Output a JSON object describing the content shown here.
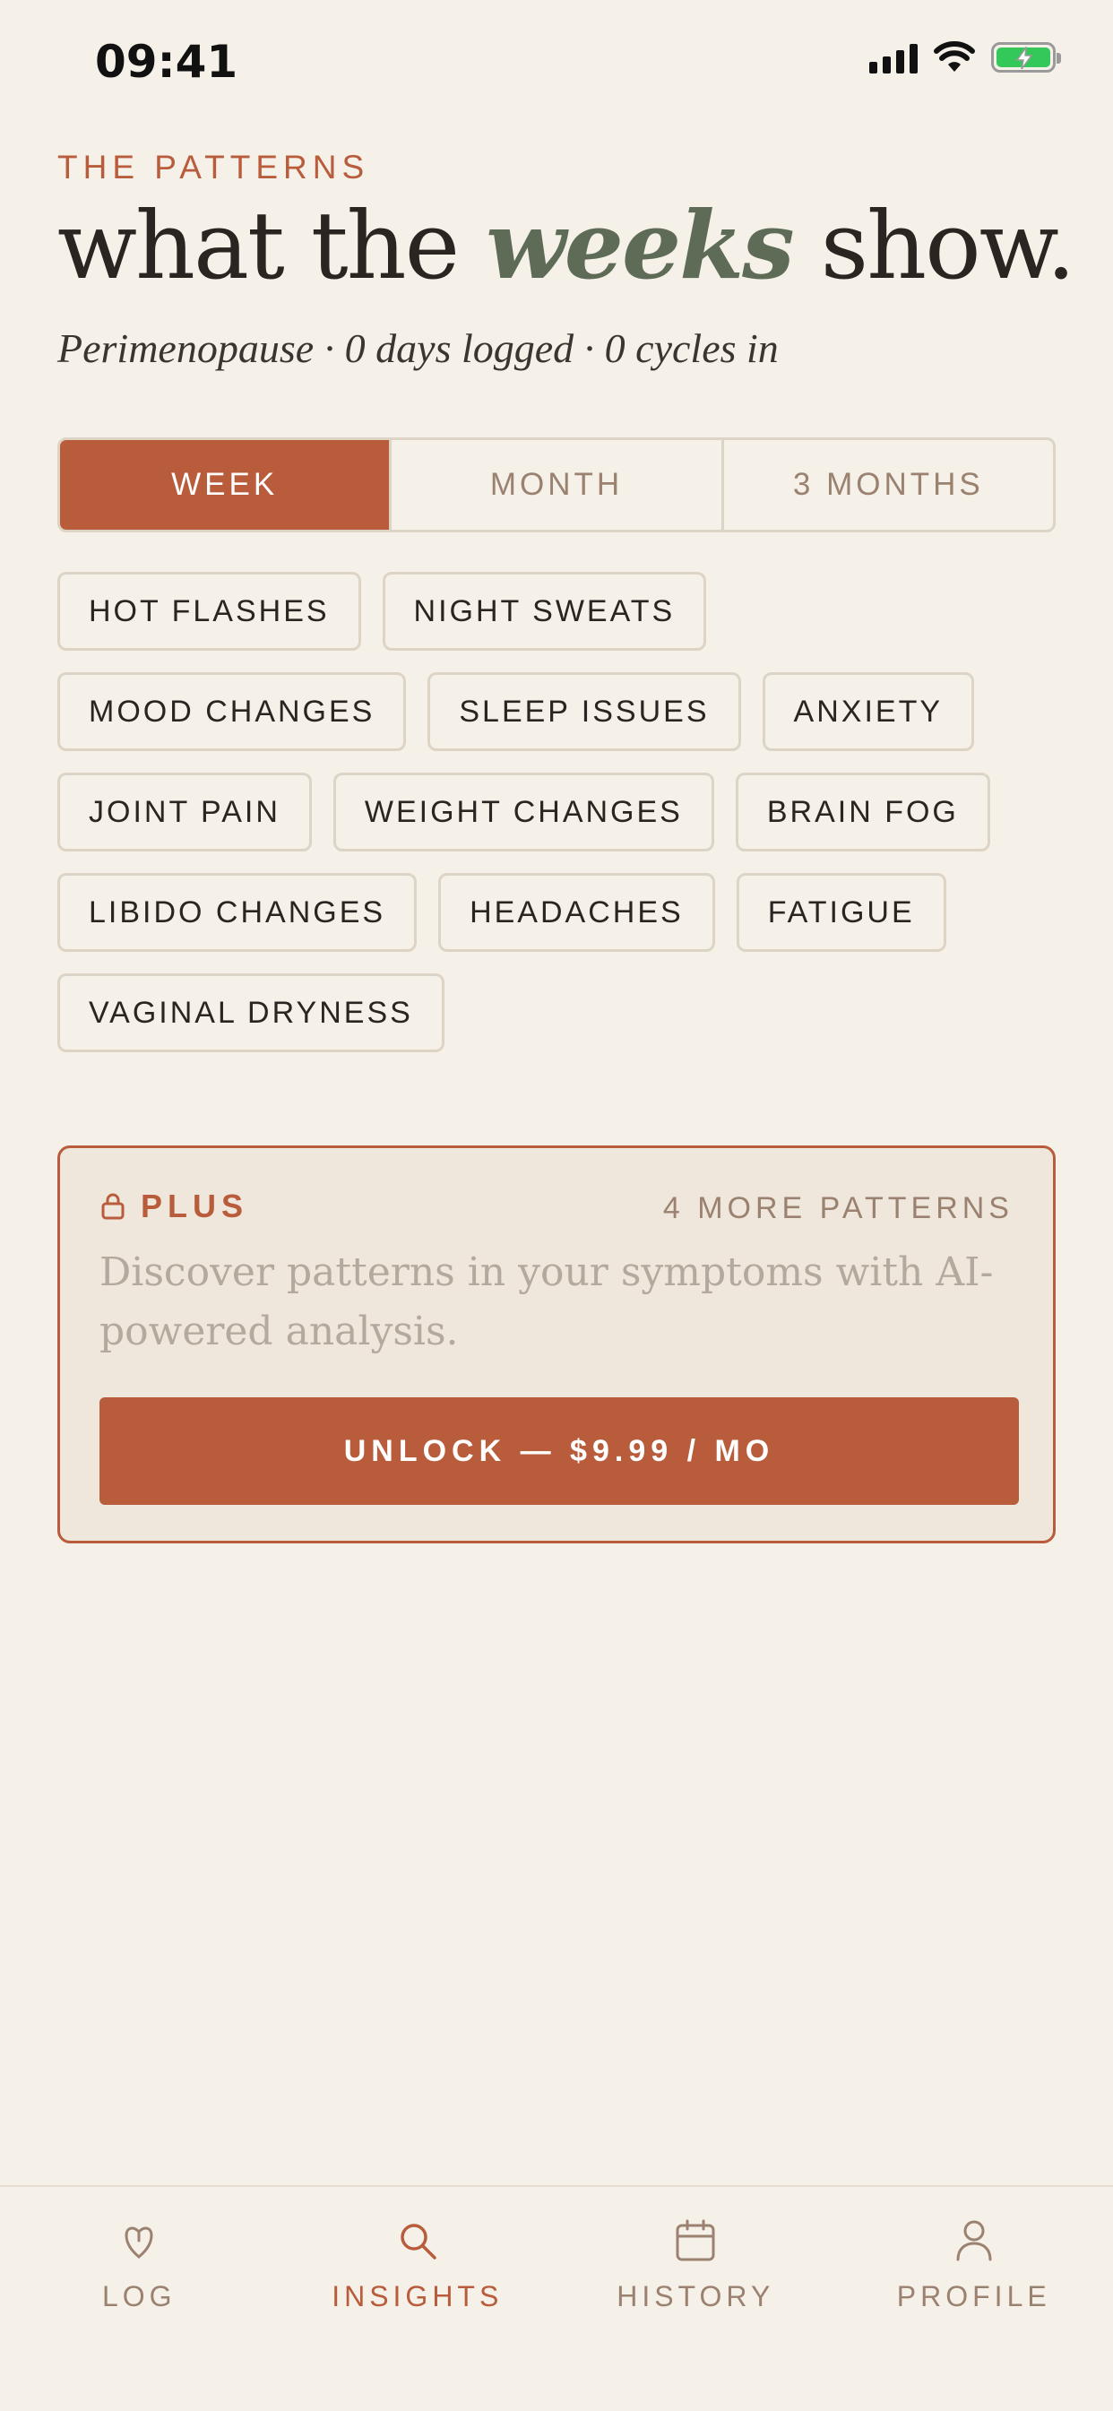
{
  "status_bar": {
    "time": "09:41"
  },
  "header": {
    "eyebrow": "THE PATTERNS",
    "title_pre": "what the",
    "title_emph": "weeks",
    "title_post": "show.",
    "subtitle": "Perimenopause · 0 days logged · 0 cycles in"
  },
  "range_selector": {
    "options": [
      "WEEK",
      "MONTH",
      "3 MONTHS"
    ],
    "selected": "WEEK"
  },
  "symptoms": {
    "rows": [
      [
        "HOT FLASHES",
        "NIGHT SWEATS"
      ],
      [
        "MOOD CHANGES",
        "SLEEP ISSUES",
        "ANXIETY"
      ],
      [
        "JOINT PAIN",
        "WEIGHT CHANGES",
        "BRAIN FOG"
      ],
      [
        "LIBIDO CHANGES",
        "HEADACHES",
        "FATIGUE"
      ],
      [
        "VAGINAL DRYNESS"
      ]
    ]
  },
  "plus_card": {
    "label": "PLUS",
    "more": "4 MORE PATTERNS",
    "description": "Discover patterns in your symptoms with AI-powered analysis.",
    "cta": "UNLOCK — $9.99 / MO"
  },
  "tabbar": {
    "items": [
      {
        "label": "LOG",
        "icon": "heart-drop-icon"
      },
      {
        "label": "INSIGHTS",
        "icon": "search-icon"
      },
      {
        "label": "HISTORY",
        "icon": "calendar-icon"
      },
      {
        "label": "PROFILE",
        "icon": "person-icon"
      }
    ],
    "active": "INSIGHTS"
  },
  "colors": {
    "background": "#f5f0e8",
    "accent": "#b85c3c",
    "sage": "#5e6b57",
    "muted": "#9b8270",
    "battery": "#34c759"
  }
}
